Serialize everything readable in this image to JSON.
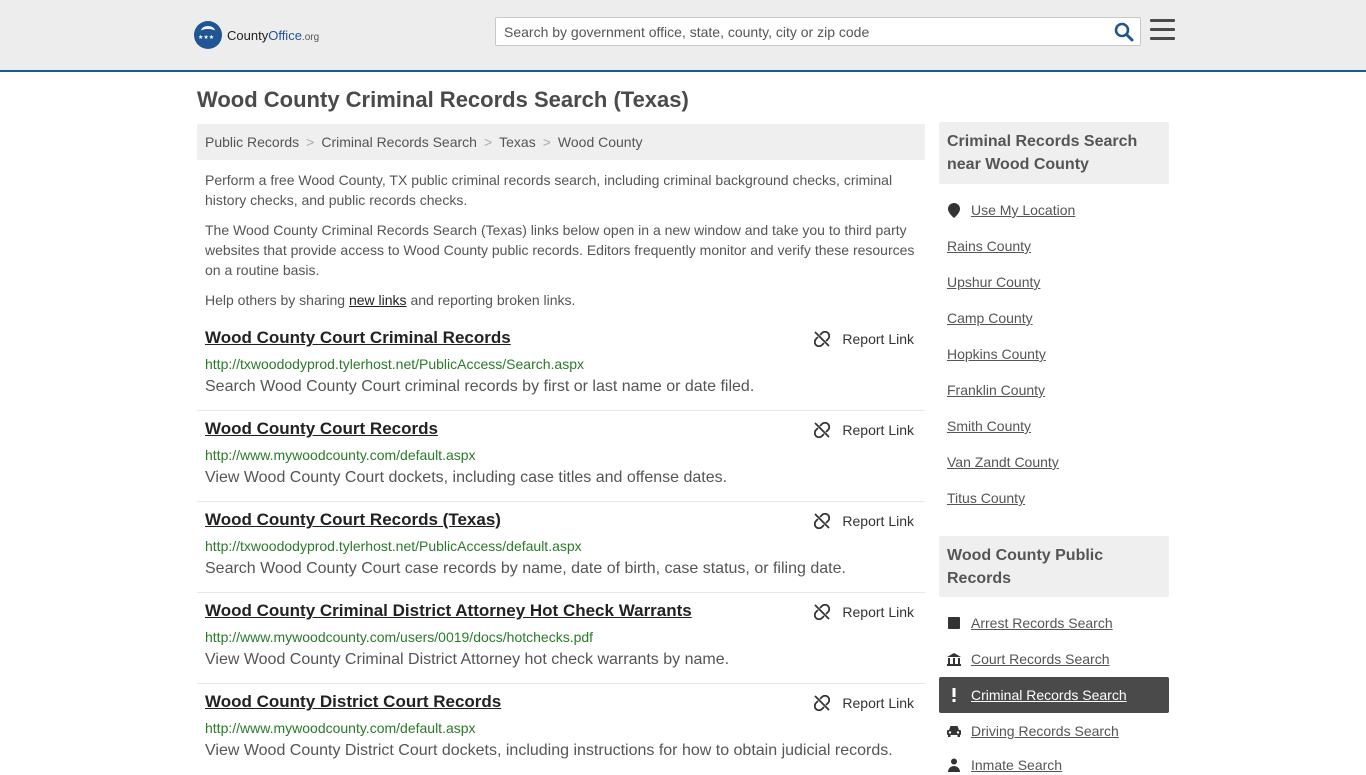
{
  "header": {
    "logo_main": "County",
    "logo_accent": "Office",
    "logo_tld": ".org",
    "search_placeholder": "Search by government office, state, county, city or zip code"
  },
  "page_title": "Wood County Criminal Records Search (Texas)",
  "breadcrumb": [
    "Public Records",
    "Criminal Records Search",
    "Texas",
    "Wood County"
  ],
  "intro": {
    "p1": "Perform a free Wood County, TX public criminal records search, including criminal background checks, criminal history checks, and public records checks.",
    "p2": "The Wood County Criminal Records Search (Texas) links below open in a new window and take you to third party websites that provide access to Wood County public records. Editors frequently monitor and verify these resources on a routine basis.",
    "p3_before": "Help others by sharing ",
    "p3_link": "new links",
    "p3_after": " and reporting broken links."
  },
  "report_label": "Report Link",
  "results": [
    {
      "title": "Wood County Court Criminal Records",
      "url": "http://txwoododyprod.tylerhost.net/PublicAccess/Search.aspx",
      "desc": "Search Wood County Court criminal records by first or last name or date filed."
    },
    {
      "title": "Wood County Court Records",
      "url": "http://www.mywoodcounty.com/default.aspx",
      "desc": "View Wood County Court dockets, including case titles and offense dates."
    },
    {
      "title": "Wood County Court Records (Texas)",
      "url": "http://txwoododyprod.tylerhost.net/PublicAccess/default.aspx",
      "desc": "Search Wood County Court case records by name, date of birth, case status, or filing date."
    },
    {
      "title": "Wood County Criminal District Attorney Hot Check Warrants",
      "url": "http://www.mywoodcounty.com/users/0019/docs/hotchecks.pdf",
      "desc": "View Wood County Criminal District Attorney hot check warrants by name."
    },
    {
      "title": "Wood County District Court Records",
      "url": "http://www.mywoodcounty.com/default.aspx",
      "desc": "View Wood County District Court dockets, including instructions for how to obtain judicial records."
    }
  ],
  "sidebar": {
    "nearby_heading": "Criminal Records Search near Wood County",
    "use_location": "Use My Location",
    "nearby": [
      "Rains County",
      "Upshur County",
      "Camp County",
      "Hopkins County",
      "Franklin County",
      "Smith County",
      "Van Zandt County",
      "Titus County"
    ],
    "records_heading": "Wood County Public Records",
    "records": [
      {
        "label": "Arrest Records Search",
        "icon": "square-icon"
      },
      {
        "label": "Court Records Search",
        "icon": "courthouse-icon"
      },
      {
        "label": "Criminal Records Search",
        "icon": "exclamation-icon",
        "active": true
      },
      {
        "label": "Driving Records Search",
        "icon": "car-icon"
      },
      {
        "label": "Inmate Search",
        "icon": "inmate-icon"
      }
    ]
  }
}
